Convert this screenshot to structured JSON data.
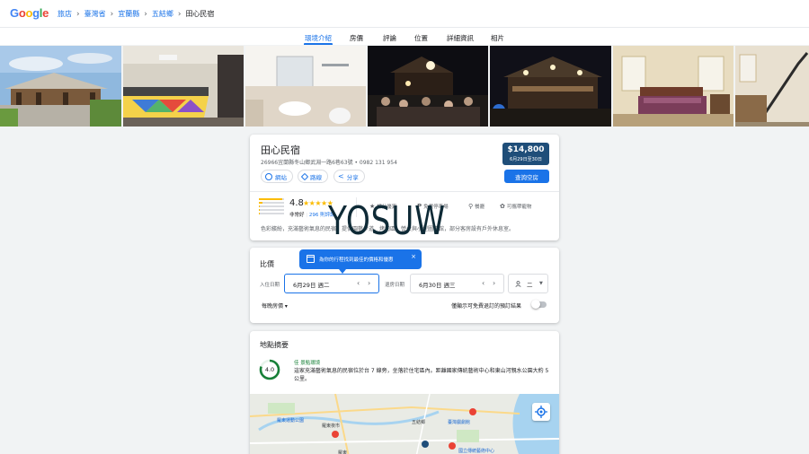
{
  "header": {
    "logo_letters": [
      "G",
      "o",
      "o",
      "g",
      "l",
      "e"
    ],
    "breadcrumbs": [
      "旅店",
      "臺灣省",
      "宜蘭縣",
      "五結鄉"
    ],
    "current": "田心民宿"
  },
  "tabs": [
    "環境介紹",
    "房價",
    "評論",
    "位置",
    "詳細資訊",
    "相片"
  ],
  "hotel": {
    "name": "田心民宿",
    "address": "26966宜蘭縣冬山鄉武淵一路6巷63號 • 0982 131 954",
    "actions": [
      "網站",
      "路線",
      "分享"
    ],
    "price": "$14,800",
    "price_dates": "6月29日至30日",
    "check_button": "查詢空房",
    "rating": "4.8",
    "stars": "★★★★★",
    "rating_word": "非常好",
    "rating_count": "296 則評論",
    "rating_sep": " | ",
    "rating_distribution": [
      0.92,
      0.15,
      0.05,
      0.03,
      0.03
    ],
    "amenities": [
      "評分優異",
      "免費停車場",
      "餐廳",
      "可攜帶寵物"
    ],
    "description": "色彩繽紛，充滿藝術氣息的民宿，提供園藝步道、烤肉區、營火與小型圖書館，部分客房設有戶外休息室。"
  },
  "watermark": "YOSUW",
  "compare": {
    "title": "比價",
    "tooltip": "為你的行程找到最佳的價格和優惠",
    "tooltip_close": "×",
    "checkin_label": "入住日期",
    "checkin_value": "6月29日 週二",
    "checkout_label": "退房日期",
    "checkout_value": "6月30日 週三",
    "guests_value": "二",
    "per_night": "每晚房價 ▾",
    "free_cancel": "僅顯示可免費退訂的預訂結果"
  },
  "location": {
    "title": "地點摘要",
    "score": "4.0",
    "score_fraction": 0.8,
    "label": "佳 景點環境",
    "description": "這家充滿藝術氣息的民宿位於台 7 線旁，坐落於住宅區內。距離國家傳統藝術中心和東山河親水公園大約 5 公里。",
    "map_labels": [
      "羅東運動公園",
      "羅東夜市",
      "五結鄉",
      "臺灣戲劇館",
      "羅東",
      "國立傳統藝術中心"
    ]
  },
  "colors": {
    "accent": "#1a73e8",
    "price_bg": "#1f4e79",
    "star": "#fbbc04",
    "score_ring": "#188038"
  }
}
